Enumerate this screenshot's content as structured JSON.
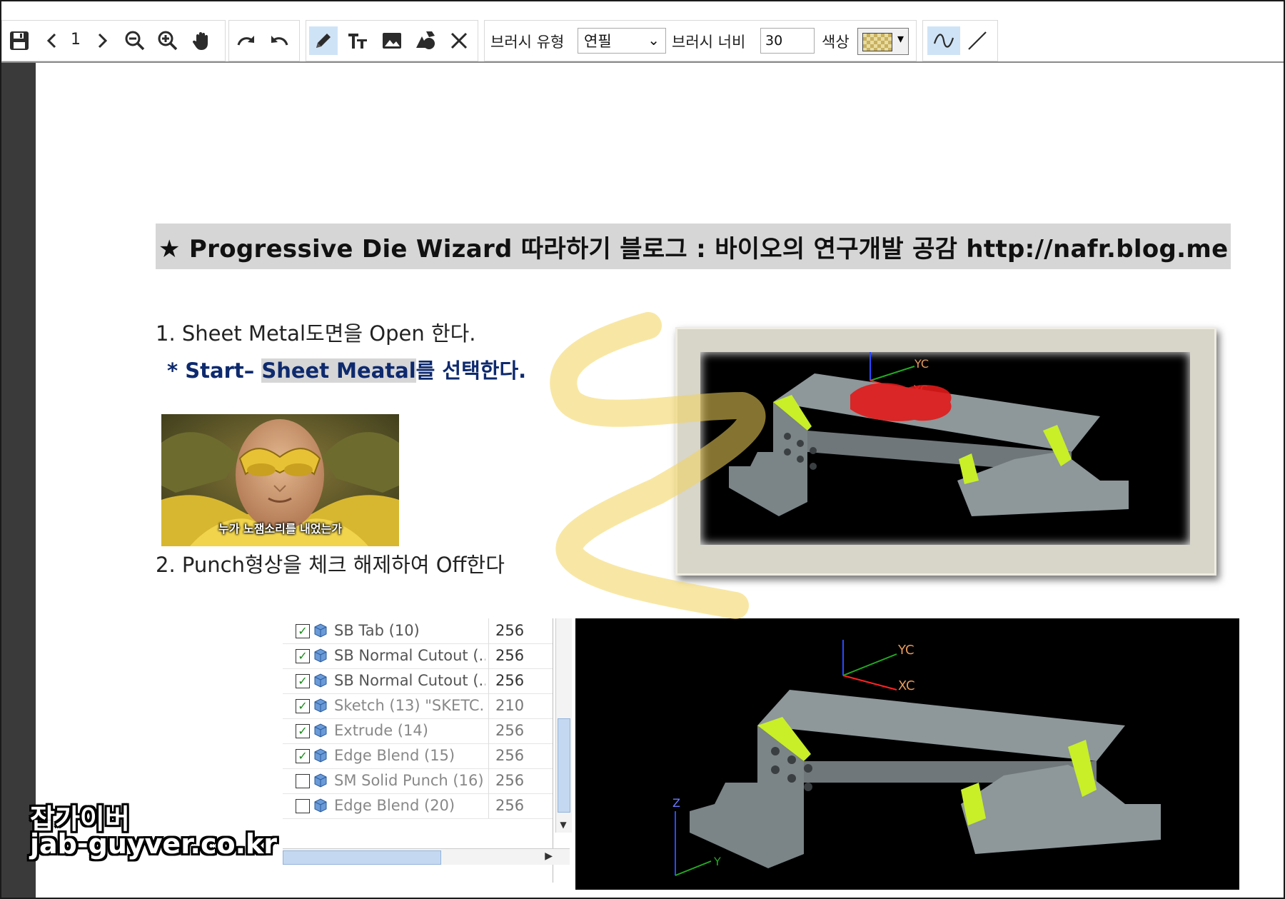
{
  "toolbar": {
    "page_number": "1",
    "brush_type_label": "브러시 유형",
    "brush_type_value": "연필",
    "brush_width_label": "브러시 너비",
    "brush_width_value": "30",
    "color_label": "색상",
    "icons": [
      "save-icon",
      "prev-page-icon",
      "next-page-icon",
      "zoom-out-icon",
      "zoom-in-icon",
      "hand-icon",
      "redo-icon",
      "undo-icon",
      "pencil-icon",
      "text-icon",
      "image-icon",
      "shapes-icon",
      "close-icon",
      "freehand-icon",
      "line-icon"
    ]
  },
  "document": {
    "heading": "★ Progressive Die Wizard 따라하기 블로그 : 바이오의 연구개발 공감 http://nafr.blog.me",
    "step1": "1. Sheet Metal도면을 Open 한다.",
    "step1_sub_prefix": "* Start– ",
    "step1_sub_highlight": "Sheet Meatal",
    "step1_sub_suffix": "를 선택한다.",
    "meme_caption": "누가 노잼소리를 내었는가",
    "cad1_axes": [
      "YC",
      "XC"
    ],
    "step2": "2. Punch형상을 체크 해제하여 Off한다",
    "cad2_axes": [
      "YC",
      "XC",
      "Z",
      "Y"
    ]
  },
  "tree": [
    {
      "name": "SB Tab (10)",
      "value": "256",
      "checked": true,
      "dim": false
    },
    {
      "name": "SB Normal Cutout (...",
      "value": "256",
      "checked": true,
      "dim": false
    },
    {
      "name": "SB Normal Cutout (...",
      "value": "256",
      "checked": true,
      "dim": false
    },
    {
      "name": "Sketch (13) \"SKETC...",
      "value": "210",
      "checked": true,
      "dim": true
    },
    {
      "name": "Extrude (14)",
      "value": "256",
      "checked": true,
      "dim": true
    },
    {
      "name": "Edge Blend (15)",
      "value": "256",
      "checked": true,
      "dim": true
    },
    {
      "name": "SM Solid Punch (16)",
      "value": "256",
      "checked": false,
      "dim": true
    },
    {
      "name": "Edge Blend (20)",
      "value": "256",
      "checked": false,
      "dim": true
    }
  ],
  "watermark": {
    "line1": "잡가이버",
    "line2": "jab-guyver.co.kr"
  },
  "colors": {
    "highlighter": "#f2d45a",
    "heading_bg": "#d6d6d6",
    "sub_text": "#0e2a6e",
    "cad_part": "#8e979a",
    "cad_bend": "#c8ef28",
    "punch_red": "#e21a1a"
  }
}
